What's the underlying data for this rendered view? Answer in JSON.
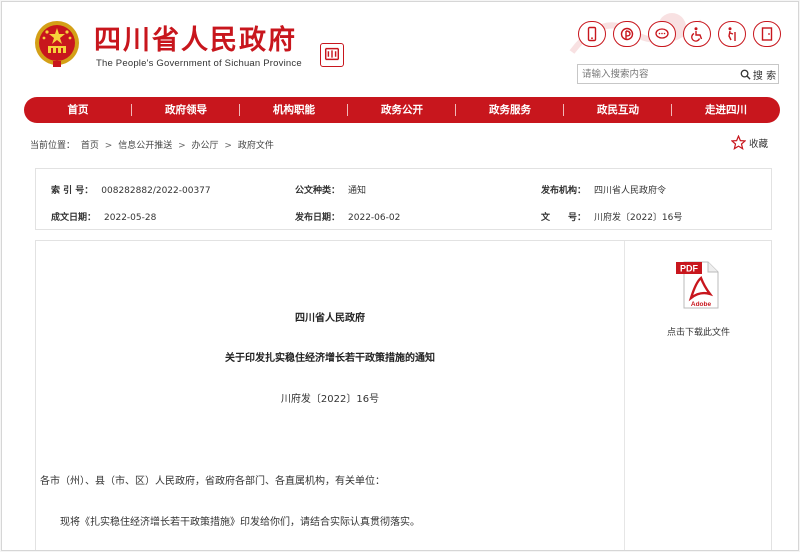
{
  "site": {
    "title": "四川省人民政府",
    "subtitle": "The People's Government of Sichuan Province",
    "seal_text": "四川"
  },
  "tools": [
    {
      "icon": "mobile-icon"
    },
    {
      "icon": "weibo-icon"
    },
    {
      "icon": "wechat-icon"
    },
    {
      "icon": "accessibility-icon"
    },
    {
      "icon": "elderly-mode-icon"
    },
    {
      "icon": "exit-icon"
    }
  ],
  "search": {
    "placeholder": "请输入搜索内容",
    "button_label": "搜 索"
  },
  "nav": {
    "items": [
      "首页",
      "政府领导",
      "机构职能",
      "政务公开",
      "政务服务",
      "政民互动",
      "走进四川"
    ]
  },
  "breadcrumb": {
    "prefix": "当前位置：",
    "items": [
      "首页",
      "信息公开推送",
      "办公厅",
      "政府文件"
    ],
    "sep": ">"
  },
  "favorite": {
    "label": "收藏"
  },
  "meta": {
    "index_label": "索 引 号：",
    "index_value": "008282882/2022-00377",
    "type_label": "公文种类：",
    "type_value": "通知",
    "org_label": "发布机构：",
    "org_value": "四川省人民政府令",
    "written_label": "成文日期：",
    "written_value": "2022-05-28",
    "published_label": "发布日期：",
    "published_value": "2022-06-02",
    "doc_label": "文　　号：",
    "doc_value": "川府发〔2022〕16号"
  },
  "download": {
    "label": "点击下载此文件",
    "pdf_text": "PDF",
    "adobe_text": "Adobe"
  },
  "document": {
    "issuer": "四川省人民政府",
    "title": "关于印发扎实稳住经济增长若干政策措施的通知",
    "number": "川府发〔2022〕16号",
    "para1": "各市（州）、县（市、区）人民政府，省政府各部门、各直属机构，有关单位：",
    "para2": "现将《扎实稳住经济增长若干政策措施》印发给你们，请结合实际认真贯彻落实。"
  },
  "colors": {
    "brand_red": "#c8161d"
  }
}
